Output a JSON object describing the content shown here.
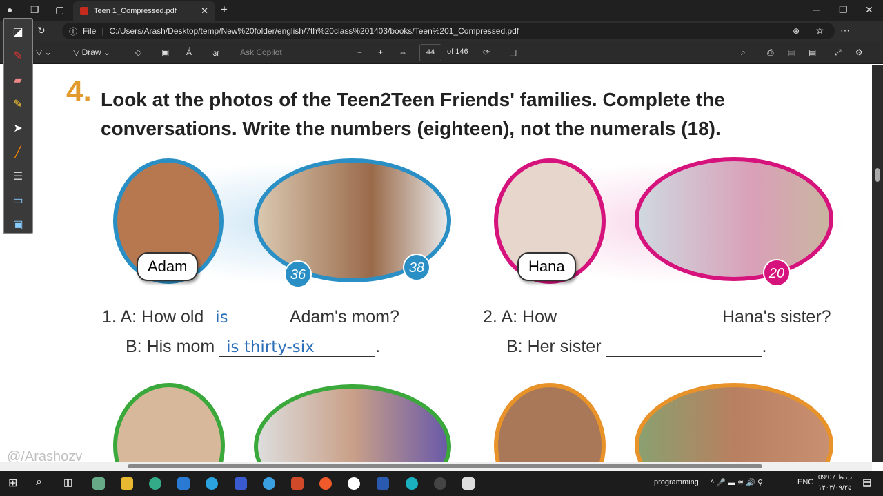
{
  "browser": {
    "tab_title": "Teen 1_Compressed.pdf",
    "address_prefix": "File",
    "url": "C:/Users/Arash/Desktop/temp/New%20folder/english/7th%20class%201403/books/Teen%201_Compressed.pdf"
  },
  "pdf_toolbar": {
    "draw_label": "Draw",
    "ask_copilot": "Ask Copilot",
    "page_current": "44",
    "page_total": "of 146"
  },
  "document": {
    "exercise_number": "4.",
    "instruction": "Look at the photos of the Teen2Teen Friends' families. Complete the conversations. Write the numbers (eighteen), not the numerals (18).",
    "group1": {
      "name": "Adam",
      "ages": [
        "36",
        "38"
      ]
    },
    "group2": {
      "name": "Hana",
      "ages": [
        "20"
      ]
    },
    "conv1": {
      "num": "1.",
      "a_label": "A:",
      "a_pre": "How old",
      "a_answer": "is",
      "a_post": "Adam's mom?",
      "b_label": "B:",
      "b_pre": "His mom",
      "b_answer": "is thirty-six",
      "b_post": "."
    },
    "conv2": {
      "num": "2.",
      "a_label": "A:",
      "a_pre": "How",
      "a_post": "Hana's sister?",
      "b_label": "B:",
      "b_pre": "Her sister",
      "b_post": "."
    }
  },
  "watermark": "@/Arashozv",
  "taskbar": {
    "workspace": "programming",
    "language": "ENG",
    "time": "09:07 ب.ظ",
    "date": "۱۴۰۳/۰۹/۲۵"
  },
  "colors": {
    "blue": "#2a8fc4",
    "magenta": "#d6127c",
    "green": "#3aa83a",
    "orange": "#e8922a",
    "ink": "#2c6fb8"
  }
}
